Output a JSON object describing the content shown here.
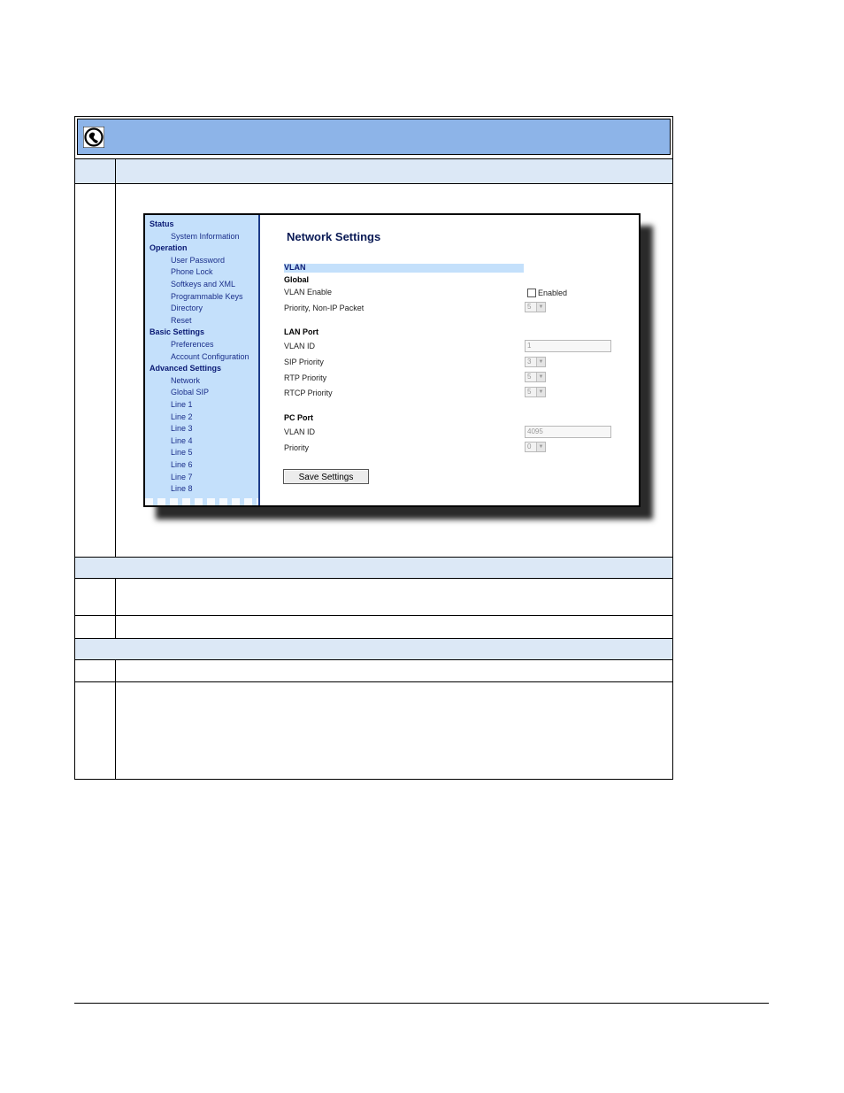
{
  "nav": {
    "items": [
      {
        "label": "Status",
        "kind": "head"
      },
      {
        "label": "System Information",
        "kind": "item"
      },
      {
        "label": "Operation",
        "kind": "head"
      },
      {
        "label": "User Password",
        "kind": "item"
      },
      {
        "label": "Phone Lock",
        "kind": "item"
      },
      {
        "label": "Softkeys and XML",
        "kind": "item"
      },
      {
        "label": "Programmable Keys",
        "kind": "item"
      },
      {
        "label": "Directory",
        "kind": "item"
      },
      {
        "label": "Reset",
        "kind": "item"
      },
      {
        "label": "Basic Settings",
        "kind": "head"
      },
      {
        "label": "Preferences",
        "kind": "item"
      },
      {
        "label": "Account Configuration",
        "kind": "item"
      },
      {
        "label": "Advanced Settings",
        "kind": "head"
      },
      {
        "label": "Network",
        "kind": "item"
      },
      {
        "label": "Global SIP",
        "kind": "item"
      },
      {
        "label": "Line 1",
        "kind": "item"
      },
      {
        "label": "Line 2",
        "kind": "item"
      },
      {
        "label": "Line 3",
        "kind": "item"
      },
      {
        "label": "Line 4",
        "kind": "item"
      },
      {
        "label": "Line 5",
        "kind": "item"
      },
      {
        "label": "Line 6",
        "kind": "item"
      },
      {
        "label": "Line 7",
        "kind": "item"
      },
      {
        "label": "Line 8",
        "kind": "item"
      }
    ]
  },
  "page": {
    "title": "Network Settings",
    "section": "VLAN",
    "global": {
      "heading": "Global",
      "vlan_enable_label": "VLAN Enable",
      "enabled_label": "Enabled",
      "enabled": false,
      "priority_label": "Priority, Non-IP Packet",
      "priority_value": "5"
    },
    "lan_port": {
      "heading": "LAN Port",
      "vlan_id_label": "VLAN ID",
      "vlan_id_value": "1",
      "sip_priority_label": "SIP Priority",
      "sip_priority_value": "3",
      "rtp_priority_label": "RTP Priority",
      "rtp_priority_value": "5",
      "rtcp_priority_label": "RTCP Priority",
      "rtcp_priority_value": "5"
    },
    "pc_port": {
      "heading": "PC Port",
      "vlan_id_label": "VLAN ID",
      "vlan_id_value": "4095",
      "priority_label": "Priority",
      "priority_value": "0"
    },
    "save_label": "Save Settings"
  },
  "colors": {
    "header_bar": "#8db4e8",
    "nav_bg": "#c4e0fb",
    "band": "#dce8f6"
  }
}
